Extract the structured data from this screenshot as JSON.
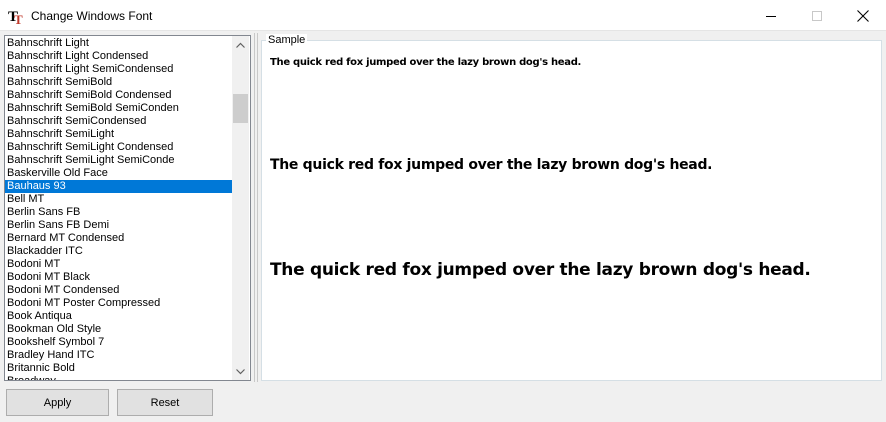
{
  "window": {
    "title": "Change Windows Font",
    "icon": "font-tt-icon",
    "controls": {
      "minimize_icon": "minimize-icon",
      "maximize_icon": "maximize-icon",
      "close_icon": "close-icon"
    }
  },
  "font_list": {
    "items": [
      {
        "label": "Bahnschrift Light"
      },
      {
        "label": "Bahnschrift Light Condensed"
      },
      {
        "label": "Bahnschrift Light SemiCondensed"
      },
      {
        "label": "Bahnschrift SemiBold"
      },
      {
        "label": "Bahnschrift SemiBold Condensed"
      },
      {
        "label": "Bahnschrift SemiBold SemiConden"
      },
      {
        "label": "Bahnschrift SemiCondensed"
      },
      {
        "label": "Bahnschrift SemiLight"
      },
      {
        "label": "Bahnschrift SemiLight Condensed"
      },
      {
        "label": "Bahnschrift SemiLight SemiConde"
      },
      {
        "label": "Baskerville Old Face"
      },
      {
        "label": "Bauhaus 93"
      },
      {
        "label": "Bell MT"
      },
      {
        "label": "Berlin Sans FB"
      },
      {
        "label": "Berlin Sans FB Demi"
      },
      {
        "label": "Bernard MT Condensed"
      },
      {
        "label": "Blackadder ITC"
      },
      {
        "label": "Bodoni MT"
      },
      {
        "label": "Bodoni MT Black"
      },
      {
        "label": "Bodoni MT Condensed"
      },
      {
        "label": "Bodoni MT Poster Compressed"
      },
      {
        "label": "Book Antiqua"
      },
      {
        "label": "Bookman Old Style"
      },
      {
        "label": "Bookshelf Symbol 7"
      },
      {
        "label": "Bradley Hand ITC"
      },
      {
        "label": "Britannic Bold"
      },
      {
        "label": "Broadway"
      }
    ],
    "selected": "Bauhaus 93",
    "selection_color": "#0078d7"
  },
  "sample": {
    "label": "Sample",
    "text_small": "The quick red fox jumped over the lazy brown dog's head.",
    "text_medium": "The quick red fox jumped over the lazy brown dog's head.",
    "text_large": "The quick red fox jumped over the lazy brown dog's head."
  },
  "buttons": {
    "apply": "Apply",
    "reset": "Reset"
  }
}
